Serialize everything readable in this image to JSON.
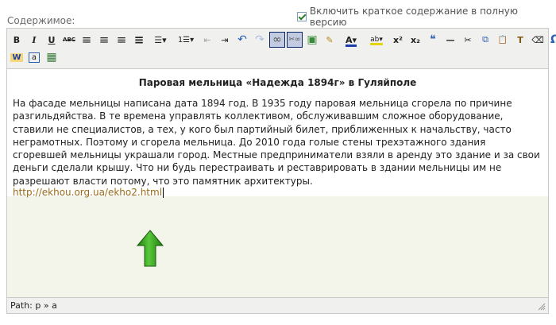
{
  "form": {
    "content_label": "Содержимое:",
    "summary_checkbox": {
      "label": "Включить краткое содержание в полную версию",
      "checked": true
    }
  },
  "toolbar": {
    "row1": [
      {
        "icon": "bold-icon",
        "glyph": "B"
      },
      {
        "icon": "italic-icon",
        "glyph": "I"
      },
      {
        "icon": "underline-icon",
        "glyph": "U"
      },
      {
        "icon": "strikethrough-icon",
        "glyph": "ABC"
      },
      {
        "icon": "align-left-icon",
        "glyph": "≡"
      },
      {
        "icon": "align-center-icon",
        "glyph": "≡"
      },
      {
        "icon": "align-right-icon",
        "glyph": "≡"
      },
      {
        "icon": "align-justify-icon",
        "glyph": "≡"
      },
      {
        "icon": "bullet-list-icon",
        "glyph": "☰▾"
      },
      {
        "icon": "numbered-list-icon",
        "glyph": "1☰▾"
      },
      {
        "icon": "outdent-icon",
        "glyph": "⇤"
      },
      {
        "icon": "indent-icon",
        "glyph": "⇥"
      },
      {
        "icon": "undo-icon",
        "glyph": "↶"
      },
      {
        "icon": "redo-icon",
        "glyph": "↷"
      },
      {
        "icon": "link-icon",
        "glyph": "∞"
      },
      {
        "icon": "unlink-icon",
        "glyph": "✂∞"
      },
      {
        "icon": "image-icon",
        "glyph": "▣"
      },
      {
        "icon": "cleanup-icon",
        "glyph": "✎"
      },
      {
        "icon": "text-color-icon",
        "glyph": "A▾"
      },
      {
        "icon": "background-color-icon",
        "glyph": "ab▾"
      },
      {
        "icon": "superscript-icon",
        "glyph": "x²"
      },
      {
        "icon": "subscript-icon",
        "glyph": "x₂"
      },
      {
        "icon": "blockquote-icon",
        "glyph": "❝"
      },
      {
        "icon": "horizontal-rule-icon",
        "glyph": "—"
      },
      {
        "icon": "cut-icon",
        "glyph": "✂"
      },
      {
        "icon": "copy-icon",
        "glyph": "⧉"
      },
      {
        "icon": "paste-icon",
        "glyph": "📋"
      },
      {
        "icon": "paste-text-icon",
        "glyph": "T"
      },
      {
        "icon": "remove-format-icon",
        "glyph": "⌫"
      },
      {
        "icon": "special-char-icon",
        "glyph": "Ω"
      }
    ],
    "row2": [
      {
        "icon": "paste-word-icon",
        "glyph": "W"
      },
      {
        "icon": "select-all-icon",
        "glyph": "a"
      },
      {
        "icon": "media-icon",
        "glyph": "▦"
      }
    ]
  },
  "document": {
    "title": "Паровая мельница «Надежда 1894г» в Гуляйполе",
    "paragraph": "На фасаде мельницы написана дата 1894 год. В 1935 году паровая мельница сгорела по причине разгильдяйства. В те времена управлять коллективом, обслуживавшим сложное оборудование, ставили не специалистов, а тех, у кого был партийный билет, приближенных к начальству, часто неграмотных. Поэтому и сгорела мельница. До 2010 года голые стены трехэтажного здания сгоревшей мельницы украшали город. Местные предприниматели взяли в аренду это здание и за свои деньги сделали крышу. Что ни будь перестраивать и реставрировать в здании мельницы им не разрешают власти потому, что это памятник архитектуры.",
    "link": "http://ekhou.org.ua/ekho2.html"
  },
  "statusbar": {
    "path": "Path: p » a"
  },
  "colors": {
    "arrow": "#2f9a1f",
    "link": "#9a6b1a",
    "editor_bg": "#f4f5ea",
    "toolbar_bg": "#f0f0ee"
  }
}
